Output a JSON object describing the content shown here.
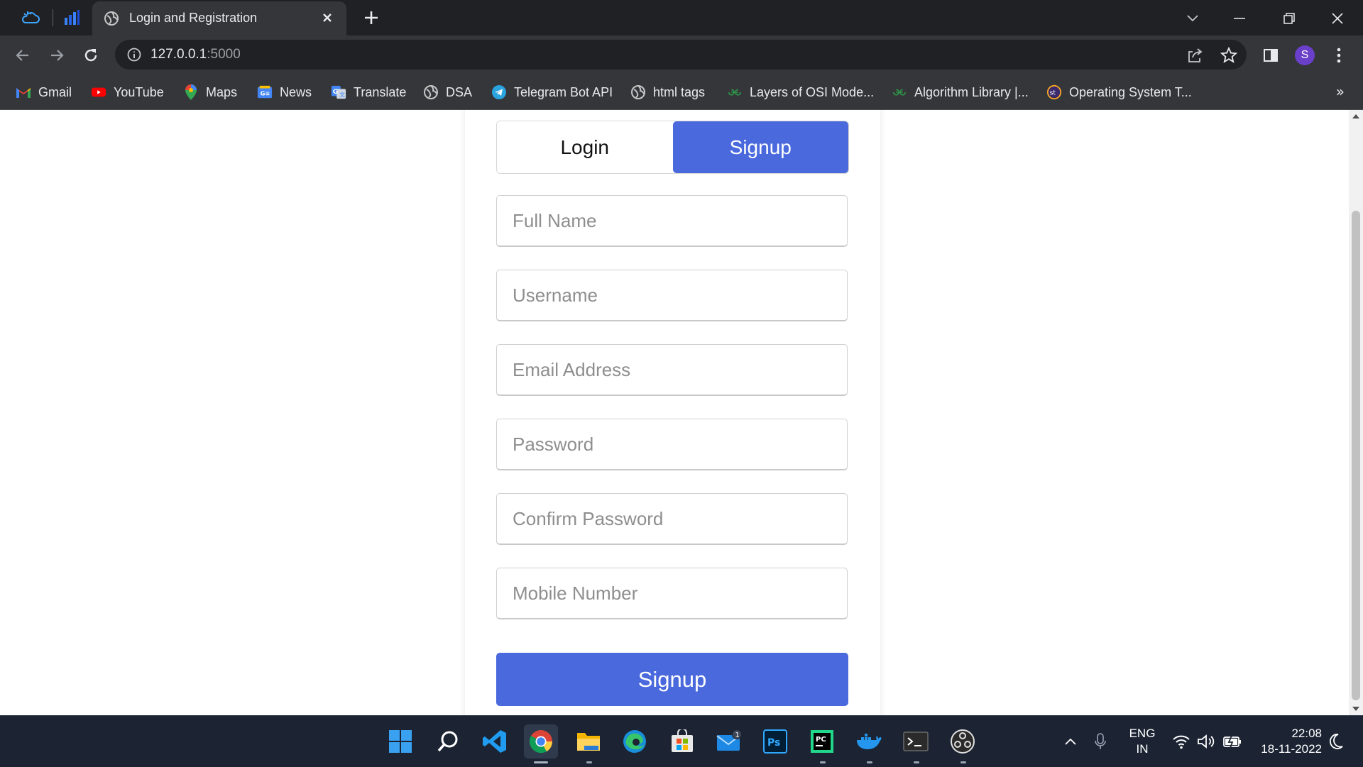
{
  "browser": {
    "tab_title": "Login and Registration",
    "url_host": "127.0.0.1",
    "url_port": ":5000",
    "profile_initial": "S"
  },
  "bookmarks": [
    {
      "label": "Gmail",
      "icon": "gmail-icon"
    },
    {
      "label": "YouTube",
      "icon": "youtube-icon"
    },
    {
      "label": "Maps",
      "icon": "maps-icon"
    },
    {
      "label": "News",
      "icon": "news-icon"
    },
    {
      "label": "Translate",
      "icon": "translate-icon"
    },
    {
      "label": "DSA",
      "icon": "globe-icon"
    },
    {
      "label": "Telegram Bot API",
      "icon": "telegram-icon"
    },
    {
      "label": "html tags",
      "icon": "globe-icon"
    },
    {
      "label": "Layers of OSI Mode...",
      "icon": "geeksforgeeks-icon"
    },
    {
      "label": "Algorithm Library |...",
      "icon": "geeksforgeeks-icon"
    },
    {
      "label": "Operating System T...",
      "icon": "studytonight-icon"
    }
  ],
  "bookmarks_more": "»",
  "form": {
    "tab_login": "Login",
    "tab_signup": "Signup",
    "active_tab": "signup",
    "fields": [
      {
        "name": "full-name-field",
        "placeholder": "Full Name",
        "value": ""
      },
      {
        "name": "username-field",
        "placeholder": "Username",
        "value": ""
      },
      {
        "name": "email-field",
        "placeholder": "Email Address",
        "value": ""
      },
      {
        "name": "password-field",
        "placeholder": "Password",
        "value": ""
      },
      {
        "name": "confirm-password-field",
        "placeholder": "Confirm Password",
        "value": ""
      },
      {
        "name": "mobile-number-field",
        "placeholder": "Mobile Number",
        "value": ""
      }
    ],
    "submit_label": "Signup"
  },
  "taskbar": {
    "apps": [
      "windows-start-icon",
      "search-icon",
      "vscode-icon",
      "chrome-icon",
      "file-explorer-icon",
      "edge-icon",
      "microsoft-store-icon",
      "mail-icon",
      "photoshop-icon",
      "pycharm-icon",
      "docker-icon",
      "terminal-icon",
      "obs-icon"
    ],
    "mail_badge": "1",
    "language": "ENG",
    "region": "IN",
    "time": "22:08",
    "date": "18-11-2022"
  },
  "colors": {
    "accent": "#4a69dd",
    "chrome_dark": "#202124",
    "chrome_mid": "#35363a",
    "taskbar": "#1c2433"
  }
}
